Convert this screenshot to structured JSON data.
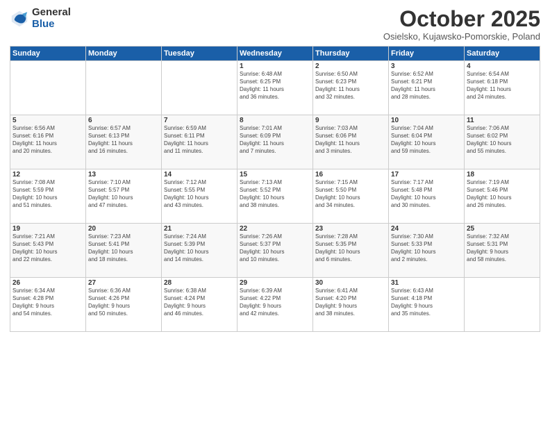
{
  "logo": {
    "general": "General",
    "blue": "Blue"
  },
  "title": "October 2025",
  "subtitle": "Osielsko, Kujawsko-Pomorskie, Poland",
  "weekdays": [
    "Sunday",
    "Monday",
    "Tuesday",
    "Wednesday",
    "Thursday",
    "Friday",
    "Saturday"
  ],
  "weeks": [
    [
      {
        "day": "",
        "info": ""
      },
      {
        "day": "",
        "info": ""
      },
      {
        "day": "",
        "info": ""
      },
      {
        "day": "1",
        "info": "Sunrise: 6:48 AM\nSunset: 6:25 PM\nDaylight: 11 hours\nand 36 minutes."
      },
      {
        "day": "2",
        "info": "Sunrise: 6:50 AM\nSunset: 6:23 PM\nDaylight: 11 hours\nand 32 minutes."
      },
      {
        "day": "3",
        "info": "Sunrise: 6:52 AM\nSunset: 6:21 PM\nDaylight: 11 hours\nand 28 minutes."
      },
      {
        "day": "4",
        "info": "Sunrise: 6:54 AM\nSunset: 6:18 PM\nDaylight: 11 hours\nand 24 minutes."
      }
    ],
    [
      {
        "day": "5",
        "info": "Sunrise: 6:56 AM\nSunset: 6:16 PM\nDaylight: 11 hours\nand 20 minutes."
      },
      {
        "day": "6",
        "info": "Sunrise: 6:57 AM\nSunset: 6:13 PM\nDaylight: 11 hours\nand 16 minutes."
      },
      {
        "day": "7",
        "info": "Sunrise: 6:59 AM\nSunset: 6:11 PM\nDaylight: 11 hours\nand 11 minutes."
      },
      {
        "day": "8",
        "info": "Sunrise: 7:01 AM\nSunset: 6:09 PM\nDaylight: 11 hours\nand 7 minutes."
      },
      {
        "day": "9",
        "info": "Sunrise: 7:03 AM\nSunset: 6:06 PM\nDaylight: 11 hours\nand 3 minutes."
      },
      {
        "day": "10",
        "info": "Sunrise: 7:04 AM\nSunset: 6:04 PM\nDaylight: 10 hours\nand 59 minutes."
      },
      {
        "day": "11",
        "info": "Sunrise: 7:06 AM\nSunset: 6:02 PM\nDaylight: 10 hours\nand 55 minutes."
      }
    ],
    [
      {
        "day": "12",
        "info": "Sunrise: 7:08 AM\nSunset: 5:59 PM\nDaylight: 10 hours\nand 51 minutes."
      },
      {
        "day": "13",
        "info": "Sunrise: 7:10 AM\nSunset: 5:57 PM\nDaylight: 10 hours\nand 47 minutes."
      },
      {
        "day": "14",
        "info": "Sunrise: 7:12 AM\nSunset: 5:55 PM\nDaylight: 10 hours\nand 43 minutes."
      },
      {
        "day": "15",
        "info": "Sunrise: 7:13 AM\nSunset: 5:52 PM\nDaylight: 10 hours\nand 38 minutes."
      },
      {
        "day": "16",
        "info": "Sunrise: 7:15 AM\nSunset: 5:50 PM\nDaylight: 10 hours\nand 34 minutes."
      },
      {
        "day": "17",
        "info": "Sunrise: 7:17 AM\nSunset: 5:48 PM\nDaylight: 10 hours\nand 30 minutes."
      },
      {
        "day": "18",
        "info": "Sunrise: 7:19 AM\nSunset: 5:46 PM\nDaylight: 10 hours\nand 26 minutes."
      }
    ],
    [
      {
        "day": "19",
        "info": "Sunrise: 7:21 AM\nSunset: 5:43 PM\nDaylight: 10 hours\nand 22 minutes."
      },
      {
        "day": "20",
        "info": "Sunrise: 7:23 AM\nSunset: 5:41 PM\nDaylight: 10 hours\nand 18 minutes."
      },
      {
        "day": "21",
        "info": "Sunrise: 7:24 AM\nSunset: 5:39 PM\nDaylight: 10 hours\nand 14 minutes."
      },
      {
        "day": "22",
        "info": "Sunrise: 7:26 AM\nSunset: 5:37 PM\nDaylight: 10 hours\nand 10 minutes."
      },
      {
        "day": "23",
        "info": "Sunrise: 7:28 AM\nSunset: 5:35 PM\nDaylight: 10 hours\nand 6 minutes."
      },
      {
        "day": "24",
        "info": "Sunrise: 7:30 AM\nSunset: 5:33 PM\nDaylight: 10 hours\nand 2 minutes."
      },
      {
        "day": "25",
        "info": "Sunrise: 7:32 AM\nSunset: 5:31 PM\nDaylight: 9 hours\nand 58 minutes."
      }
    ],
    [
      {
        "day": "26",
        "info": "Sunrise: 6:34 AM\nSunset: 4:28 PM\nDaylight: 9 hours\nand 54 minutes."
      },
      {
        "day": "27",
        "info": "Sunrise: 6:36 AM\nSunset: 4:26 PM\nDaylight: 9 hours\nand 50 minutes."
      },
      {
        "day": "28",
        "info": "Sunrise: 6:38 AM\nSunset: 4:24 PM\nDaylight: 9 hours\nand 46 minutes."
      },
      {
        "day": "29",
        "info": "Sunrise: 6:39 AM\nSunset: 4:22 PM\nDaylight: 9 hours\nand 42 minutes."
      },
      {
        "day": "30",
        "info": "Sunrise: 6:41 AM\nSunset: 4:20 PM\nDaylight: 9 hours\nand 38 minutes."
      },
      {
        "day": "31",
        "info": "Sunrise: 6:43 AM\nSunset: 4:18 PM\nDaylight: 9 hours\nand 35 minutes."
      },
      {
        "day": "",
        "info": ""
      }
    ]
  ]
}
